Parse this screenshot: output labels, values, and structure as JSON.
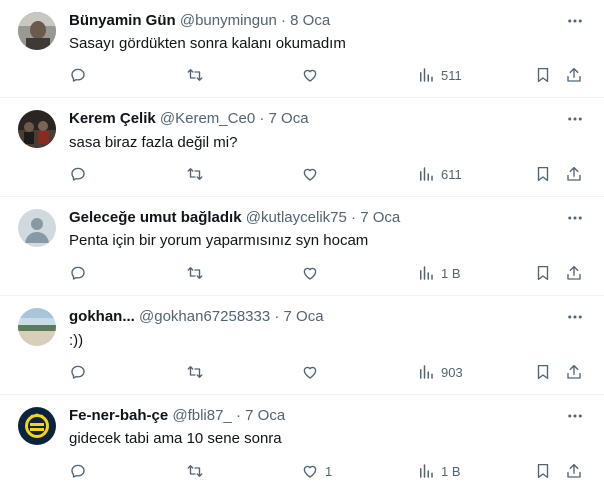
{
  "replies": [
    {
      "name": "Bünyamin Gün",
      "handle": "@bunymingun",
      "separator": "·",
      "date": "8 Oca",
      "text": "Sasayı gördükten sonra kalanı okumadım",
      "views": "511",
      "likes": "",
      "avatar": "photo"
    },
    {
      "name": "Kerem Çelik",
      "handle": "@Kerem_Ce0",
      "separator": "·",
      "date": "7 Oca",
      "text": "sasa biraz fazla değil mi?",
      "views": "611",
      "likes": "",
      "avatar": "photo-dark"
    },
    {
      "name": "Geleceğe umut bağladık",
      "handle": "@kutlaycelik75",
      "separator": "·",
      "date": "7 Oca",
      "text": "Penta için bir yorum yaparmısınız syn hocam",
      "views": "1 B",
      "likes": "",
      "avatar": "default-person"
    },
    {
      "name": "gokhan...",
      "handle": "@gokhan67258333",
      "separator": "·",
      "date": "7 Oca",
      "text": ":))",
      "views": "903",
      "likes": "",
      "avatar": "landscape"
    },
    {
      "name": "Fe-ner-bah-çe",
      "handle": "@fbli87_",
      "separator": "·",
      "date": "7 Oca",
      "text": "gidecek tabi ama 10 sene sonra",
      "views": "1 B",
      "likes": "1",
      "avatar": "club-logo"
    }
  ],
  "icons": {
    "reply": "reply-icon",
    "retweet": "retweet-icon",
    "like": "like-icon",
    "views": "views-icon",
    "bookmark": "bookmark-icon",
    "share": "share-icon",
    "more": "more-icon"
  },
  "colors": {
    "text": "#0f1419",
    "secondary": "#536471",
    "divider": "#eff3f4"
  }
}
